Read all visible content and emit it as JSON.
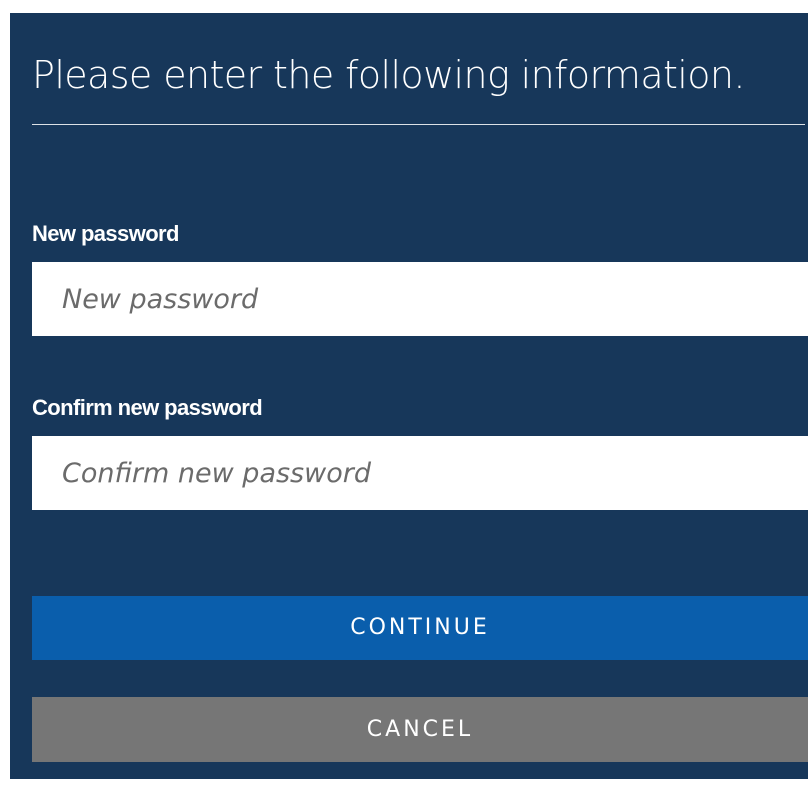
{
  "form": {
    "title": "Please enter the following information.",
    "new_password": {
      "label": "New password",
      "value": "",
      "placeholder": "New password"
    },
    "confirm_password": {
      "label": "Confirm new password",
      "value": "",
      "placeholder": "Confirm new password"
    },
    "continue_label": "CONTINUE",
    "cancel_label": "CANCEL"
  },
  "colors": {
    "panel_background": "#17375a",
    "continue_button": "#0a5eac",
    "cancel_button": "#767676",
    "text": "#ffffff",
    "input_background": "#ffffff",
    "placeholder": "#6b6b6b"
  }
}
